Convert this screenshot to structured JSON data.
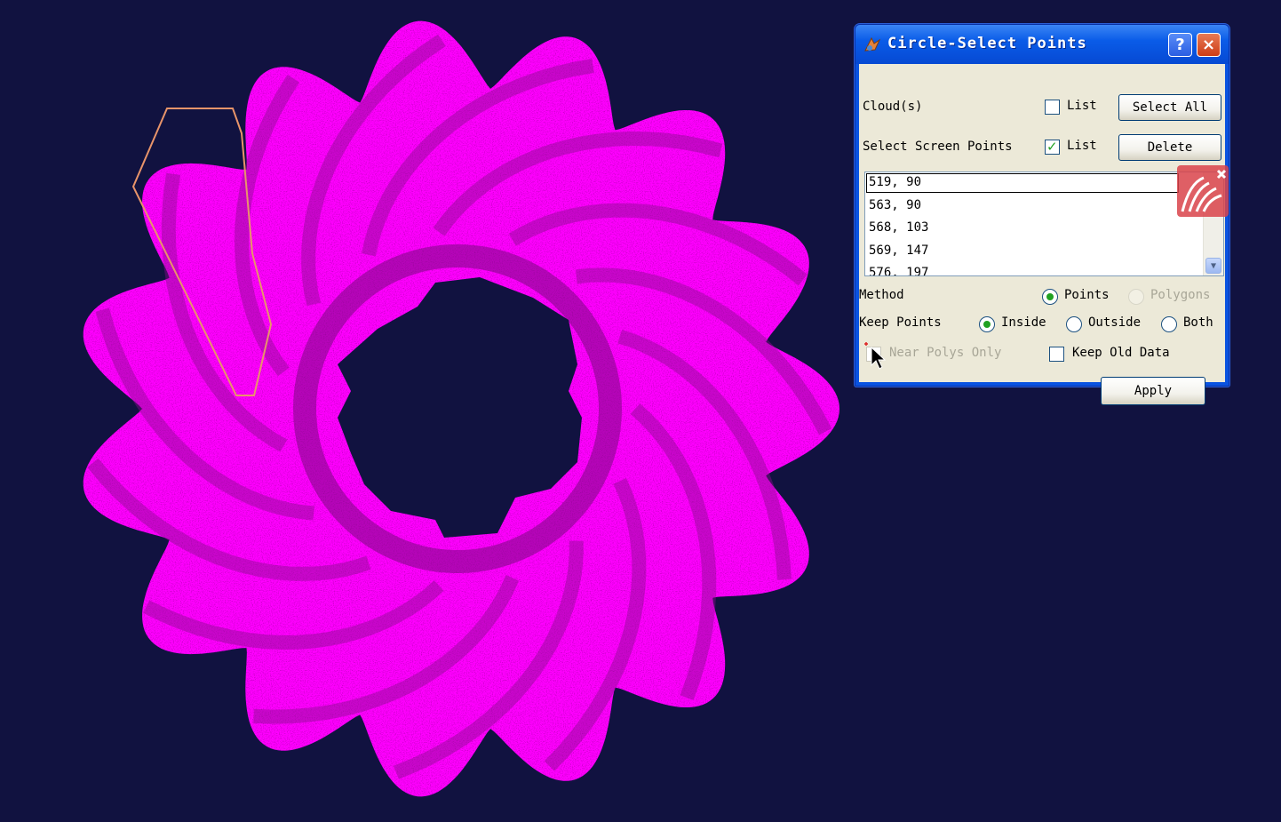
{
  "dialog": {
    "title": "Circle-Select Points",
    "help_label": "?",
    "close_label": "×",
    "clouds_label": "Cloud(s)",
    "clouds_list_label": "List",
    "clouds_list_checked": false,
    "select_all_label": "Select All",
    "select_screen_points_label": "Select Screen Points",
    "screen_points_list_label": "List",
    "screen_points_list_checked": true,
    "delete_label": "Delete",
    "points": [
      "519, 90",
      "563, 90",
      "568, 103",
      "569, 147",
      "576, 197"
    ],
    "method_label": "Method",
    "method_options": [
      "Points",
      "Polygons"
    ],
    "method_selected": "Points",
    "keep_points_label": "Keep Points",
    "keep_options": [
      "Inside",
      "Outside",
      "Both"
    ],
    "keep_selected": "Inside",
    "near_polys_only_label": "Near Polys Only",
    "near_polys_only_enabled": false,
    "keep_old_data_label": "Keep Old Data",
    "keep_old_data_checked": false,
    "apply_label": "Apply"
  },
  "viewport": {
    "background_color": "#111240",
    "cloud_color": "#ff00ff",
    "selection_outline_color": "#e8946a"
  },
  "icons": [
    "app-icon",
    "help-icon",
    "close-icon",
    "cursor-icon",
    "scroll-down-icon"
  ]
}
